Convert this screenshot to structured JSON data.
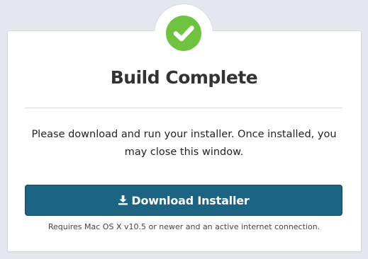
{
  "dialog": {
    "title": "Build Complete",
    "message": "Please download and run your installer. Once installed, you may close this window.",
    "download_button": {
      "label": "Download Installer",
      "icon": "download-icon"
    },
    "requirements": "Requires Mac OS X v10.5 or newer and an active internet connection.",
    "status_icon": "checkmark-icon"
  },
  "colors": {
    "background": "#e4e8ee",
    "success": "#6fc43f",
    "button": "#1b6484",
    "title_text": "#333333"
  }
}
